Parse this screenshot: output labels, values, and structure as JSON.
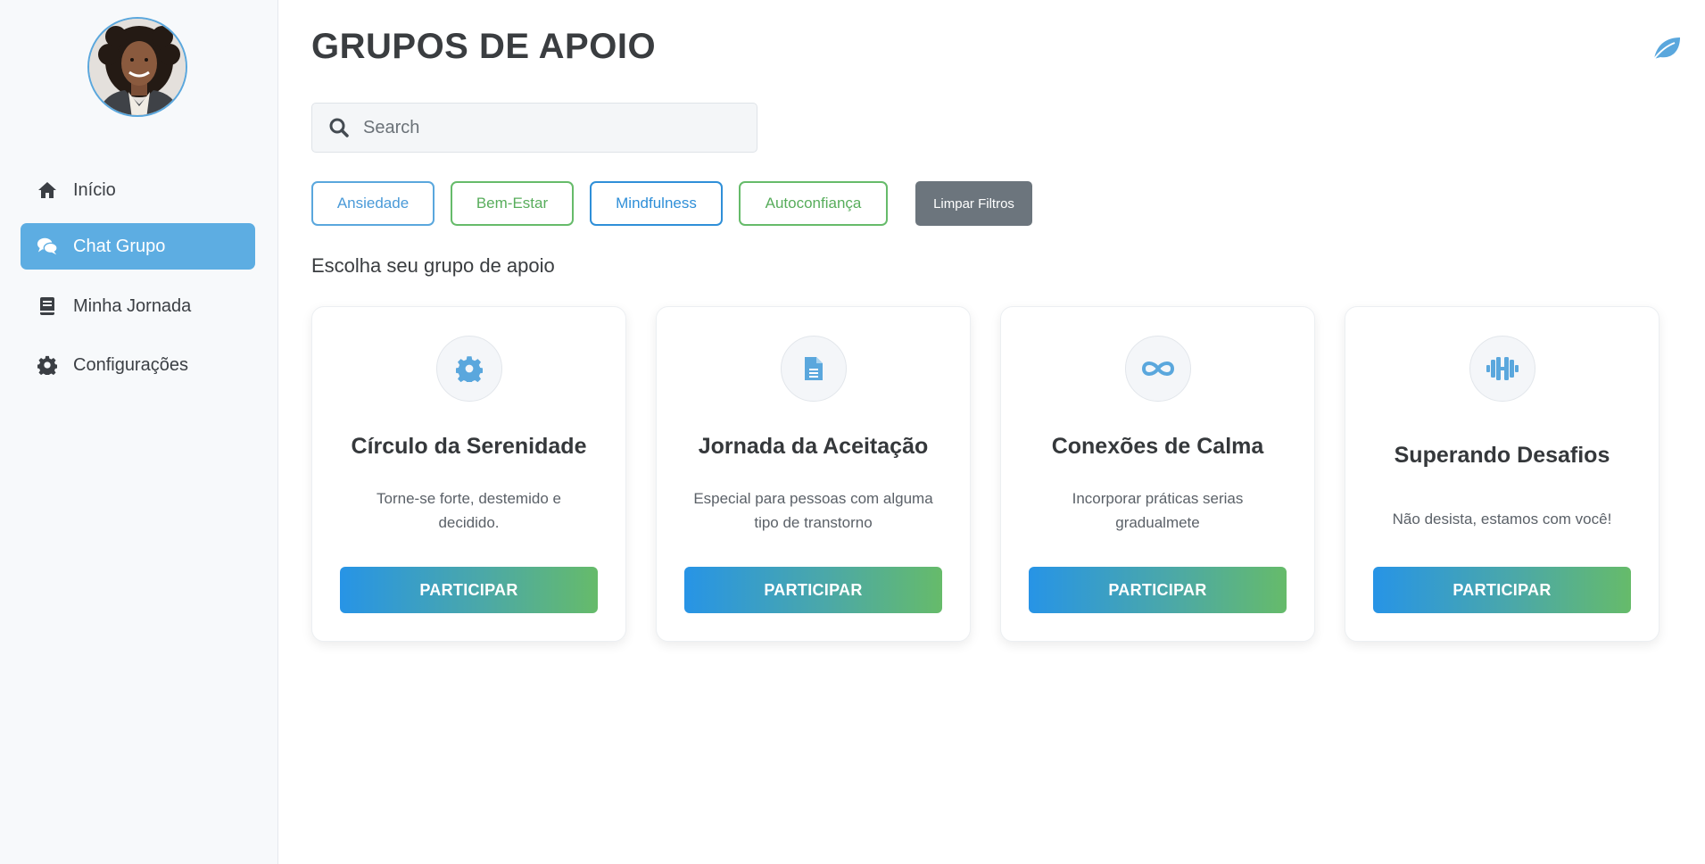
{
  "sidebar": {
    "items": [
      {
        "label": "Início",
        "icon": "home-icon",
        "active": false
      },
      {
        "label": "Chat Grupo",
        "icon": "chat-icon",
        "active": true
      },
      {
        "label": "Minha Jornada",
        "icon": "book-icon",
        "active": false
      },
      {
        "label": "Configurações",
        "icon": "gear-icon",
        "active": false
      }
    ]
  },
  "header": {
    "title": "GRUPOS DE APOIO"
  },
  "search": {
    "placeholder": "Search",
    "value": ""
  },
  "filters": [
    {
      "label": "Ansiedade",
      "color": "#5aa7dd"
    },
    {
      "label": "Bem-Estar",
      "color": "#66bb6a"
    },
    {
      "label": "Mindfulness",
      "color": "#2f8fd8"
    },
    {
      "label": "Autoconfiança",
      "color": "#66bb6a"
    }
  ],
  "clear_filters_label": "Limpar Filtros",
  "section_label": "Escolha seu grupo de apoio",
  "cards": [
    {
      "title": "Círculo da Serenidade",
      "description": "Torne-se forte, destemido e decidido.",
      "button": "PARTICIPAR",
      "icon": "gear-icon"
    },
    {
      "title": "Jornada da Aceitação",
      "description": "Especial para pessoas com alguma tipo de transtorno",
      "button": "PARTICIPAR",
      "icon": "document-icon"
    },
    {
      "title": "Conexões de Calma",
      "description": "Incorporar práticas serias gradualmete",
      "button": "PARTICIPAR",
      "icon": "infinity-icon"
    },
    {
      "title": "Superando Desafios",
      "description": "Não desista, estamos com você!",
      "button": "PARTICIPAR",
      "icon": "dumbbell-icon"
    }
  ],
  "colors": {
    "accent": "#5dade2",
    "gradient_start": "#2794e6",
    "gradient_end": "#66bb6a",
    "clear_button": "#6c757d"
  }
}
